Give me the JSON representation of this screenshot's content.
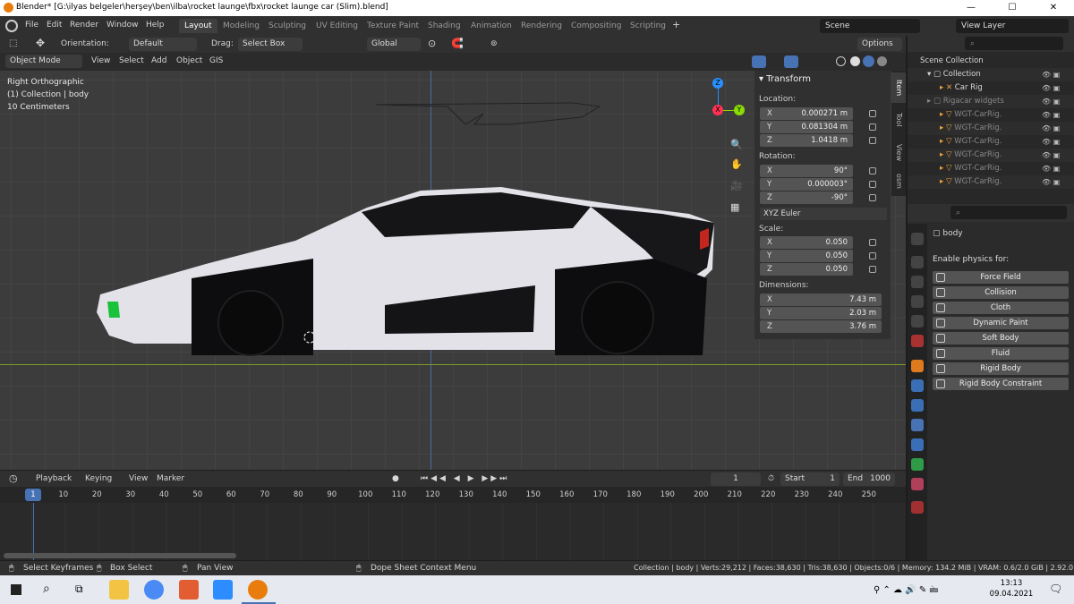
{
  "window": {
    "title": "Blender* [G:\\ilyas belgeler\\herşey\\ben\\ilba\\rocket launge\\fbx\\rocket launge car (Slim).blend]",
    "minimize": "—",
    "maximize": "☐",
    "close": "✕"
  },
  "menu": {
    "items": [
      "File",
      "Edit",
      "Render",
      "Window",
      "Help"
    ],
    "workspaces": [
      "Layout",
      "Modeling",
      "Sculpting",
      "UV Editing",
      "Texture Paint",
      "Shading",
      "Animation",
      "Rendering",
      "Compositing",
      "Scripting"
    ],
    "add_workspace": "+",
    "scene_label": "Scene",
    "view_layer_label": "View Layer"
  },
  "viewport_header": {
    "orientation_label": "Orientation:",
    "orientation_value": "Default",
    "drag_label": "Drag:",
    "drag_value": "Select Box",
    "transform_orientation": "Global",
    "options": "Options",
    "mode": "Object Mode",
    "menus": [
      "View",
      "Select",
      "Add",
      "Object",
      "GIS"
    ]
  },
  "viewport_overlay": {
    "view_name": "Right Orthographic",
    "collection_info": "(1) Collection | body",
    "scale_info": "10 Centimeters"
  },
  "gizmo": {
    "x": "X",
    "y": "Y",
    "z": "Z"
  },
  "n_panel": {
    "header": "Transform",
    "tabs": [
      "Item",
      "Tool",
      "View",
      "osm"
    ],
    "location_label": "Location:",
    "location": [
      {
        "axis": "X",
        "value": "0.000271 m"
      },
      {
        "axis": "Y",
        "value": "0.081304 m"
      },
      {
        "axis": "Z",
        "value": "1.0418 m"
      }
    ],
    "rotation_label": "Rotation:",
    "rotation": [
      {
        "axis": "X",
        "value": "90°"
      },
      {
        "axis": "Y",
        "value": "0.000003°"
      },
      {
        "axis": "Z",
        "value": "-90°"
      }
    ],
    "rotation_mode": "XYZ Euler",
    "scale_label": "Scale:",
    "scale": [
      {
        "axis": "X",
        "value": "0.050"
      },
      {
        "axis": "Y",
        "value": "0.050"
      },
      {
        "axis": "Z",
        "value": "0.050"
      }
    ],
    "dimensions_label": "Dimensions:",
    "dimensions": [
      {
        "axis": "X",
        "value": "7.43 m"
      },
      {
        "axis": "Y",
        "value": "2.03 m"
      },
      {
        "axis": "Z",
        "value": "3.76 m"
      }
    ]
  },
  "outliner": {
    "rows": [
      "Scene Collection",
      "Collection",
      "Car Rig",
      "Rigacar widgets",
      "WGT-CarRig.",
      "WGT-CarRig.",
      "WGT-CarRig.",
      "WGT-CarRig.",
      "WGT-CarRig.",
      "WGT-CarRig."
    ]
  },
  "properties": {
    "object_name": "body",
    "physics_header": "Enable physics for:",
    "physics_buttons": [
      "Force Field",
      "Collision",
      "Cloth",
      "Dynamic Paint",
      "Soft Body",
      "Fluid",
      "Rigid Body",
      "Rigid Body Constraint"
    ]
  },
  "timeline": {
    "menus": [
      "Playback",
      "Keying",
      "View",
      "Marker"
    ],
    "current_frame": "1",
    "start_label": "Start",
    "start_value": "1",
    "end_label": "End",
    "end_value": "1000",
    "ticks": [
      "1",
      "10",
      "20",
      "30",
      "40",
      "50",
      "60",
      "70",
      "80",
      "90",
      "100",
      "110",
      "120",
      "130",
      "140",
      "150",
      "160",
      "170",
      "180",
      "190",
      "200",
      "210",
      "220",
      "230",
      "240",
      "250"
    ]
  },
  "statusbar": {
    "select": "Select Keyframes",
    "box": "Box Select",
    "pan": "Pan View",
    "context": "Dope Sheet Context Menu",
    "stats": "Collection | body | Verts:29,212 | Faces:38,630 | Tris:38,630 | Objects:0/6 | Memory: 134.2 MiB | VRAM: 0.6/2.0 GiB | 2.92.0"
  },
  "taskbar": {
    "time": "13:13",
    "date": "09.04.2021"
  },
  "colors": {
    "accent": "#4772b3",
    "blender_orange": "#e87d0d",
    "axis_x": "#ff3352",
    "axis_y": "#8bdc00",
    "axis_z": "#2890ff"
  }
}
